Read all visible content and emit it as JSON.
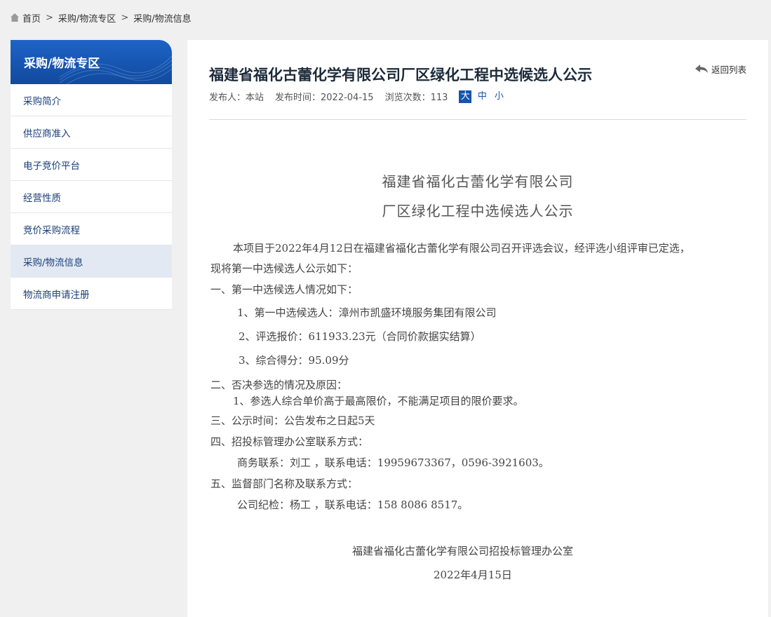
{
  "breadcrumb": {
    "home": "首页",
    "sep": ">",
    "level1": "采购/物流专区",
    "level2": "采购/物流信息"
  },
  "sidebar": {
    "title": "采购/物流专区",
    "items": [
      {
        "label": "采购简介"
      },
      {
        "label": "供应商准入"
      },
      {
        "label": "电子竞价平台"
      },
      {
        "label": "经营性质"
      },
      {
        "label": "竞价采购流程"
      },
      {
        "label": "采购/物流信息"
      },
      {
        "label": "物流商申请注册"
      }
    ],
    "active_index": 5
  },
  "article": {
    "title": "福建省福化古蕾化学有限公司厂区绿化工程中选候选人公示",
    "back_label": "返回列表",
    "publisher": "发布人：本站",
    "publish_time": "发布时间：2022-04-15",
    "views": "浏览次数：113",
    "font_sizes": [
      "大",
      "中",
      "小"
    ],
    "heading_line1": "福建省福化古蕾化学有限公司",
    "heading_line2": "厂区绿化工程中选候选人公示",
    "intro_line1": "本项目于2022年4月12日在福建省福化古蕾化学有限公司召开评选会议，经评选小组评审已定选，",
    "intro_line2": "现将第一中选候选人公示如下：",
    "s1": "一、第一中选候选人情况如下：",
    "s1_1": "1、第一中选候选人：漳州市凯盛环境服务集团有限公司",
    "s1_2": "2、评选报价：611933.23元（合同价款据实结算）",
    "s1_3": "3、综合得分：95.09分",
    "s2": "二、否决参选的情况及原因：",
    "s2_1": "1、参选人综合单价高于最高限价，不能满足项目的限价要求。",
    "s3": "三、公示时间：公告发布之日起5天",
    "s4": "四、招投标管理办公室联系方式：",
    "s4_1": "商务联系：刘工 ，联系电话：19959673367，0596-3921603。",
    "s5": "五、监督部门名称及联系方式：",
    "s5_1": "公司纪检：杨工 ，联系电话：158 8086 8517。",
    "signature": "福建省福化古蕾化学有限公司招投标管理办公室",
    "date": "2022年4月15日"
  },
  "colors": {
    "brand_blue": "#1554ae",
    "active_bg": "#e3e9f3",
    "page_bg": "#f0f0f0"
  }
}
